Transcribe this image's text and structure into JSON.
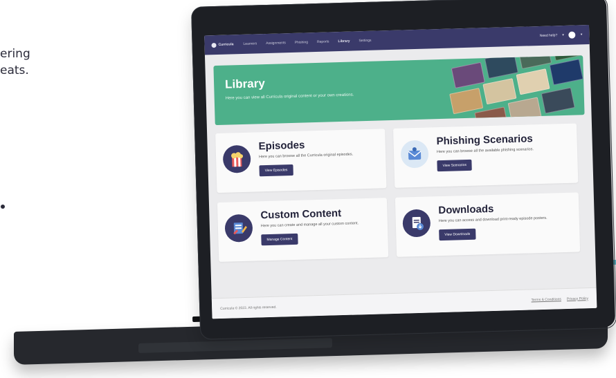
{
  "side": {
    "line1": "ering",
    "line2": "eats."
  },
  "nav": {
    "logo": "Curricula",
    "items": [
      "Learners",
      "Assignments",
      "Phishing",
      "Reports",
      "Library",
      "Settings"
    ],
    "active": "Library",
    "help": "Need help?",
    "help_chevron": "▾",
    "user_chevron": "▾"
  },
  "banner": {
    "title": "Library",
    "subtitle": "Here you can view all Curricula original content or your own creations."
  },
  "cards": [
    {
      "title": "Episodes",
      "desc": "Here you can browse all the Curricula original episodes.",
      "button": "View Episodes",
      "icon": "popcorn-icon",
      "color": "#3a3a6a"
    },
    {
      "title": "Phishing Scenarios",
      "desc": "Here you can browse all the available phishing scenarios.",
      "button": "View Scenarios",
      "icon": "email-icon",
      "color": "#dbe8f5"
    },
    {
      "title": "Custom Content",
      "desc": "Here you can create and manage all your custom content.",
      "button": "Manage Content",
      "icon": "notebook-icon",
      "color": "#3a3a6a"
    },
    {
      "title": "Downloads",
      "desc": "Here you can access and download print-ready episode posters.",
      "button": "View Downloads",
      "icon": "download-icon",
      "color": "#3a3a6a"
    }
  ],
  "footer": {
    "copyright": "Curricula © 2023. All rights reserved.",
    "terms": "Terms & Conditions",
    "privacy": "Privacy Policy"
  },
  "colors": {
    "nav": "#3a3a6a",
    "banner": "#4db08a",
    "button": "#3a3a6a",
    "accent": "#5ac4d6"
  }
}
